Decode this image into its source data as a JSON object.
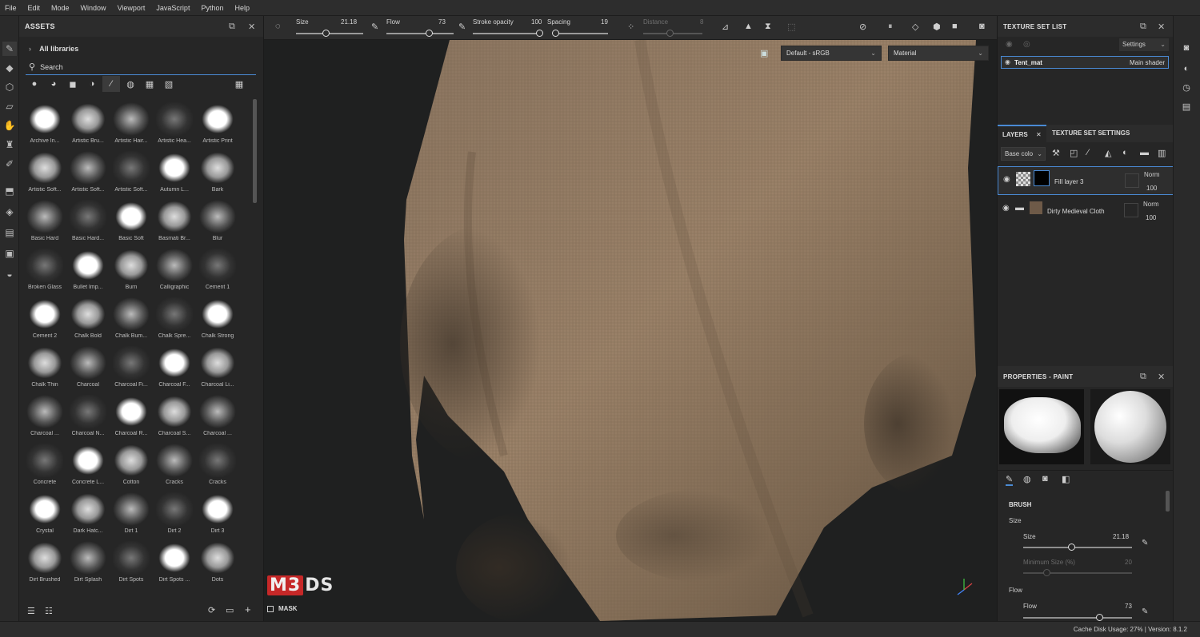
{
  "menu": [
    "File",
    "Edit",
    "Mode",
    "Window",
    "Viewport",
    "JavaScript",
    "Python",
    "Help"
  ],
  "assets": {
    "title": "ASSETS",
    "libraries": "All libraries",
    "search_value": "Search",
    "brushes": [
      "Archive In...",
      "Artistic Bru...",
      "Artistic Hair...",
      "Artistic Hea...",
      "Artistic Print",
      "Artistic Soft...",
      "Artistic Soft...",
      "Artistic Soft...",
      "Autumn L...",
      "Bark",
      "Basic Hard",
      "Basic Hard...",
      "Basic Soft",
      "Basmati Br...",
      "Blur",
      "Broken Glass",
      "Bullet Imp...",
      "Burn",
      "Calligraphic",
      "Cement 1",
      "Cement 2",
      "Chalk Bold",
      "Chalk Bum...",
      "Chalk Spre...",
      "Chalk Strong",
      "Chalk Thin",
      "Charcoal",
      "Charcoal Fi...",
      "Charcoal F...",
      "Charcoal Li...",
      "Charcoal ...",
      "Charcoal N...",
      "Charcoal R...",
      "Charcoal S...",
      "Charcoal ...",
      "Concrete",
      "Concrete L...",
      "Cotton",
      "Cracks",
      "Cracks",
      "Crystal",
      "Dark Hatc...",
      "Dirt 1",
      "Dirt 2",
      "Dirt 3",
      "Dirt Brushed",
      "Dirt Splash",
      "Dirt Spots",
      "Dirt Spots ...",
      "Dots"
    ]
  },
  "options": {
    "size_label": "Size",
    "size_value": "21.18",
    "flow_label": "Flow",
    "flow_value": "73",
    "opacity_label": "Stroke opacity",
    "opacity_value": "100",
    "spacing_label": "Spacing",
    "spacing_value": "19",
    "distance_label": "Distance",
    "distance_value": "8"
  },
  "viewport": {
    "colorspace": "Default - sRGB",
    "mode": "Material",
    "logo_a": "M3",
    "logo_b": "DS",
    "mask_label": "MASK"
  },
  "texture_set": {
    "title": "TEXTURE SET LIST",
    "settings": "Settings",
    "set_name": "Tent_mat",
    "shader": "Main shader"
  },
  "layers": {
    "tab_layers": "LAYERS",
    "tab_settings": "TEXTURE SET SETTINGS",
    "channel": "Base colo",
    "items": [
      {
        "name": "Fill layer 3",
        "blend": "Norm",
        "opacity": "100"
      },
      {
        "name": "Dirty Medieval Cloth",
        "blend": "Norm",
        "opacity": "100"
      }
    ]
  },
  "properties": {
    "title": "PROPERTIES - PAINT",
    "brush_section": "BRUSH",
    "size_group": "Size",
    "size_label": "Size",
    "size_value": "21.18",
    "min_size_label": "Minimum Size (%)",
    "min_size_value": "20",
    "flow_group": "Flow",
    "flow_label": "Flow",
    "flow_value": "73"
  },
  "status": {
    "text": "Cache Disk Usage:   27% | Version: 8.1.2"
  }
}
